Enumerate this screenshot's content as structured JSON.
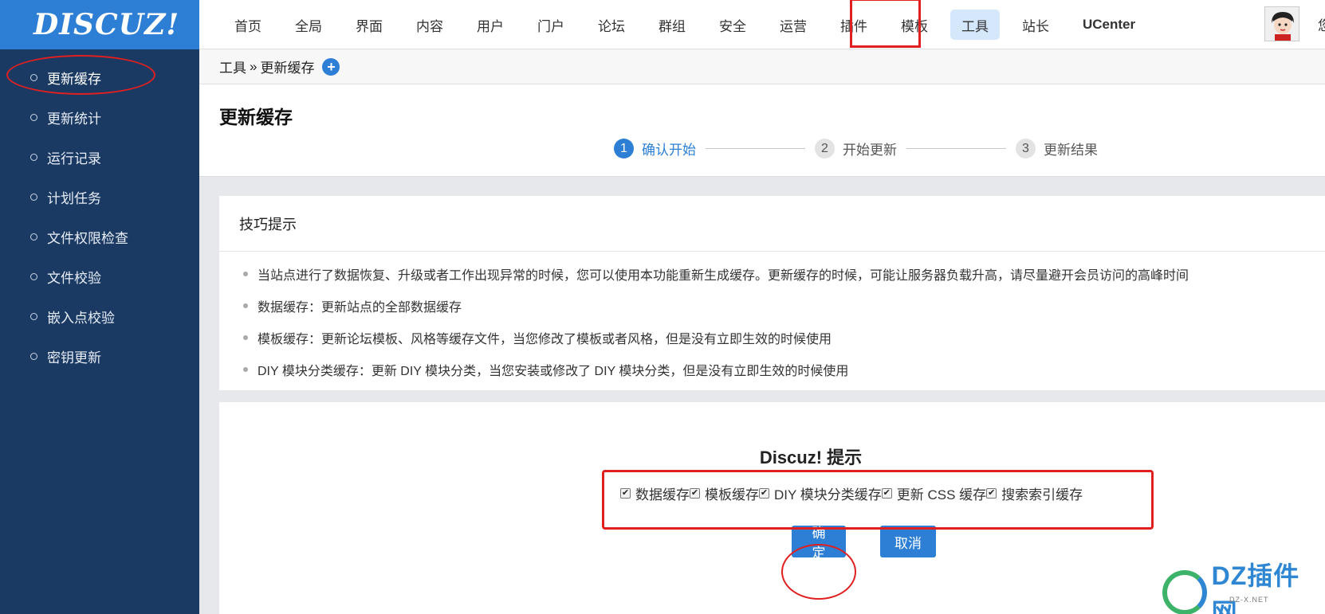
{
  "logo": {
    "text": "DISCUZ!"
  },
  "sidebar": {
    "items": [
      {
        "label": "更新缓存",
        "active": true
      },
      {
        "label": "更新统计"
      },
      {
        "label": "运行记录"
      },
      {
        "label": "计划任务"
      },
      {
        "label": "文件权限检查"
      },
      {
        "label": "文件校验"
      },
      {
        "label": "嵌入点校验"
      },
      {
        "label": "密钥更新"
      }
    ]
  },
  "topnav": {
    "items": [
      "首页",
      "全局",
      "界面",
      "内容",
      "用户",
      "门户",
      "论坛",
      "群组",
      "安全",
      "运营",
      "插件",
      "模板",
      "工具",
      "站长",
      "UCenter"
    ],
    "active": "工具",
    "edge_char": "您"
  },
  "breadcrumb": {
    "parent": "工具",
    "sep": "»",
    "current": "更新缓存"
  },
  "page": {
    "title": "更新缓存"
  },
  "steps": [
    {
      "num": "1",
      "label": "确认开始",
      "current": true
    },
    {
      "num": "2",
      "label": "开始更新"
    },
    {
      "num": "3",
      "label": "更新结果"
    }
  ],
  "tips": {
    "title": "技巧提示",
    "items": [
      "当站点进行了数据恢复、升级或者工作出现异常的时候，您可以使用本功能重新生成缓存。更新缓存的时候，可能让服务器负载升高，请尽量避开会员访问的高峰时间",
      "数据缓存：更新站点的全部数据缓存",
      "模板缓存：更新论坛模板、风格等缓存文件，当您修改了模板或者风格，但是没有立即生效的时候使用",
      "DIY 模块分类缓存：更新 DIY 模块分类，当您安装或修改了 DIY 模块分类，但是没有立即生效的时候使用"
    ]
  },
  "prompt": {
    "title": "Discuz! 提示",
    "checkboxes": [
      {
        "label": "数据缓存",
        "checked": true
      },
      {
        "label": "模板缓存",
        "checked": true
      },
      {
        "label": "DIY 模块分类缓存",
        "checked": true
      },
      {
        "label": "更新 CSS 缓存",
        "checked": true
      },
      {
        "label": "搜索索引缓存",
        "checked": true
      }
    ],
    "confirm_label": "确定",
    "cancel_label": "取消"
  },
  "watermark": {
    "text": "DZ插件网",
    "sub": "DZ-X.NET"
  },
  "colors": {
    "sidebar_bg": "#1b3a63",
    "logo_bg": "#2d7fd6",
    "accent": "#2d7fd6",
    "highlight_red": "#e02020"
  }
}
